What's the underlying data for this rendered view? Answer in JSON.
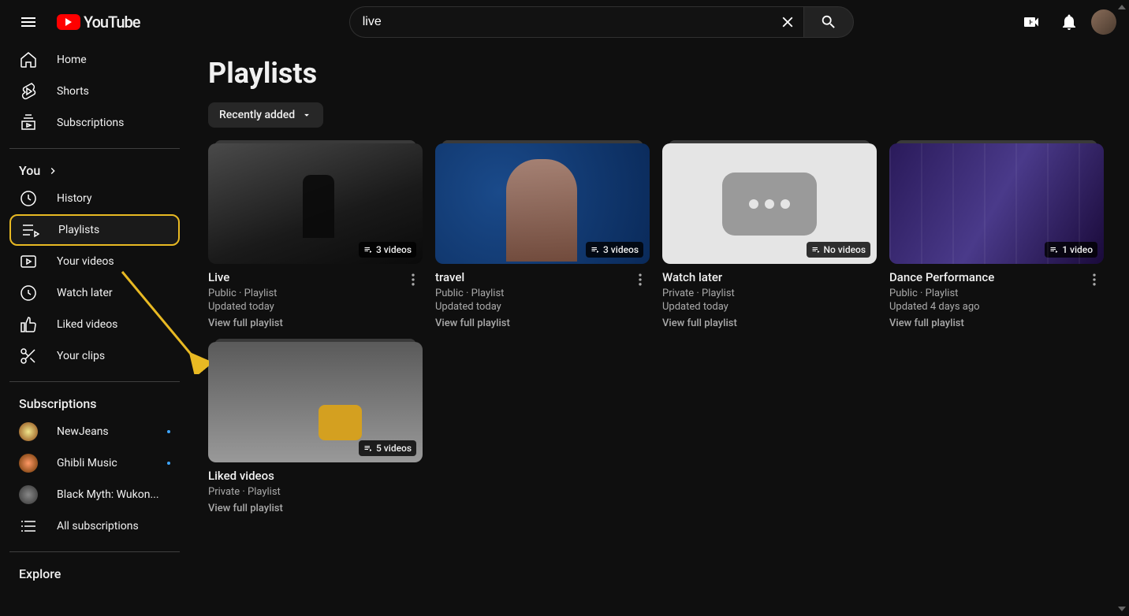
{
  "header": {
    "logo_text": "YouTube",
    "search_value": "live"
  },
  "sidebar": {
    "nav": [
      {
        "label": "Home"
      },
      {
        "label": "Shorts"
      },
      {
        "label": "Subscriptions"
      }
    ],
    "you_title": "You",
    "you_items": [
      {
        "label": "History"
      },
      {
        "label": "Playlists"
      },
      {
        "label": "Your videos"
      },
      {
        "label": "Watch later"
      },
      {
        "label": "Liked videos"
      },
      {
        "label": "Your clips"
      }
    ],
    "subscriptions_title": "Subscriptions",
    "channels": [
      {
        "name": "NewJeans",
        "dot": true
      },
      {
        "name": "Ghibli Music",
        "dot": true
      },
      {
        "name": "Black Myth: Wukon...",
        "dot": false
      }
    ],
    "all_subs": "All subscriptions",
    "explore_title": "Explore"
  },
  "main": {
    "title": "Playlists",
    "sort_label": "Recently added",
    "view_full": "View full playlist",
    "playlists": [
      {
        "title": "Live",
        "visibility": "Public · Playlist",
        "updated": "Updated today",
        "badge": "3 videos",
        "has_menu": true
      },
      {
        "title": "travel",
        "visibility": "Public · Playlist",
        "updated": "Updated today",
        "badge": "3 videos",
        "has_menu": true
      },
      {
        "title": "Watch later",
        "visibility": "Private · Playlist",
        "updated": "Updated today",
        "badge": "No videos",
        "has_menu": false
      },
      {
        "title": "Dance Performance",
        "visibility": "Public · Playlist",
        "updated": "Updated 4 days ago",
        "badge": "1 video",
        "has_menu": true
      },
      {
        "title": "Liked videos",
        "visibility": "Private · Playlist",
        "updated": "",
        "badge": "5 videos",
        "has_menu": false
      }
    ]
  }
}
